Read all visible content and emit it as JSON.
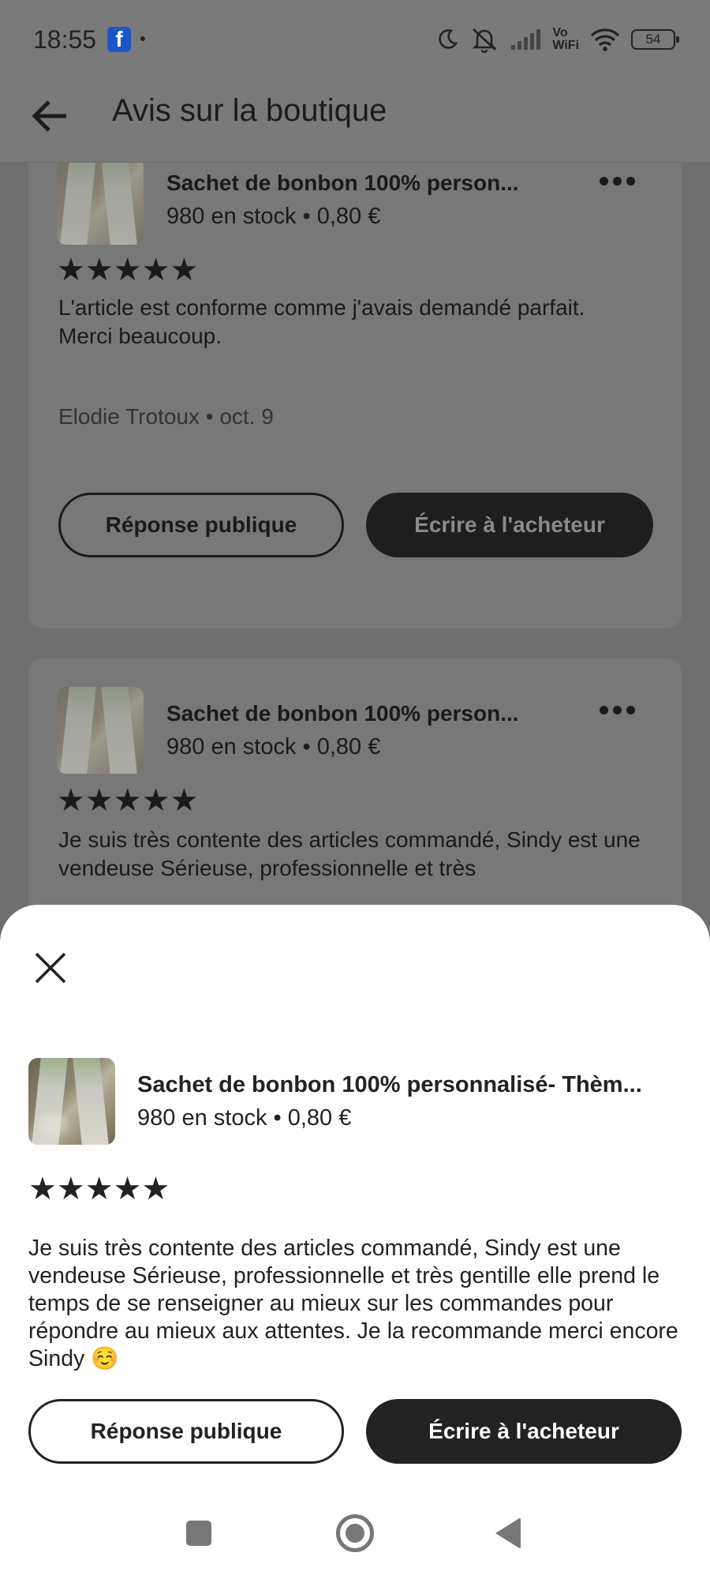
{
  "status_bar": {
    "time": "18:55",
    "notification_app": "f",
    "battery": "54",
    "icons": [
      "moon-icon",
      "mute-icon",
      "signal-icon",
      "vowifi-icon",
      "wifi-icon",
      "battery-icon"
    ],
    "vowifi_top": "Vo",
    "vowifi_bottom": "WiFi"
  },
  "app_bar": {
    "title": "Avis sur la boutique"
  },
  "reviews": [
    {
      "item_title": "Sachet de bonbon 100% person...",
      "item_stock_price": "980 en stock • 0,80 €",
      "stars": "★★★★★",
      "text": "L'article est conforme comme j'avais demandé parfait.\nMerci beaucoup.",
      "author_date": "Elodie Trotoux • oct. 9",
      "public_reply_label": "Réponse publique",
      "write_buyer_label": "Écrire à l'acheteur"
    },
    {
      "item_title": "Sachet de bonbon 100% person...",
      "item_stock_price": "980 en stock • 0,80 €",
      "stars": "★★★★★",
      "text": "Je suis très contente des articles commandé, Sindy est une vendeuse Sérieuse, professionnelle et très"
    }
  ],
  "sheet": {
    "item_title": "Sachet de bonbon 100% personnalisé- Thèm...",
    "item_stock_price": "980 en stock • 0,80 €",
    "stars": "★★★★★",
    "text": "Je suis très contente des articles commandé, Sindy est une vendeuse Sérieuse, professionnelle et très gentille elle prend le temps de se renseigner au mieux sur les commandes pour répondre au mieux aux attentes. Je la recommande merci encore Sindy ☺️",
    "public_reply_label": "Réponse publique",
    "write_buyer_label": "Écrire à l'acheteur"
  },
  "colors": {
    "overlay": "#6f6f6f",
    "primary_button": "#222222",
    "sheet_bg": "#ffffff"
  }
}
